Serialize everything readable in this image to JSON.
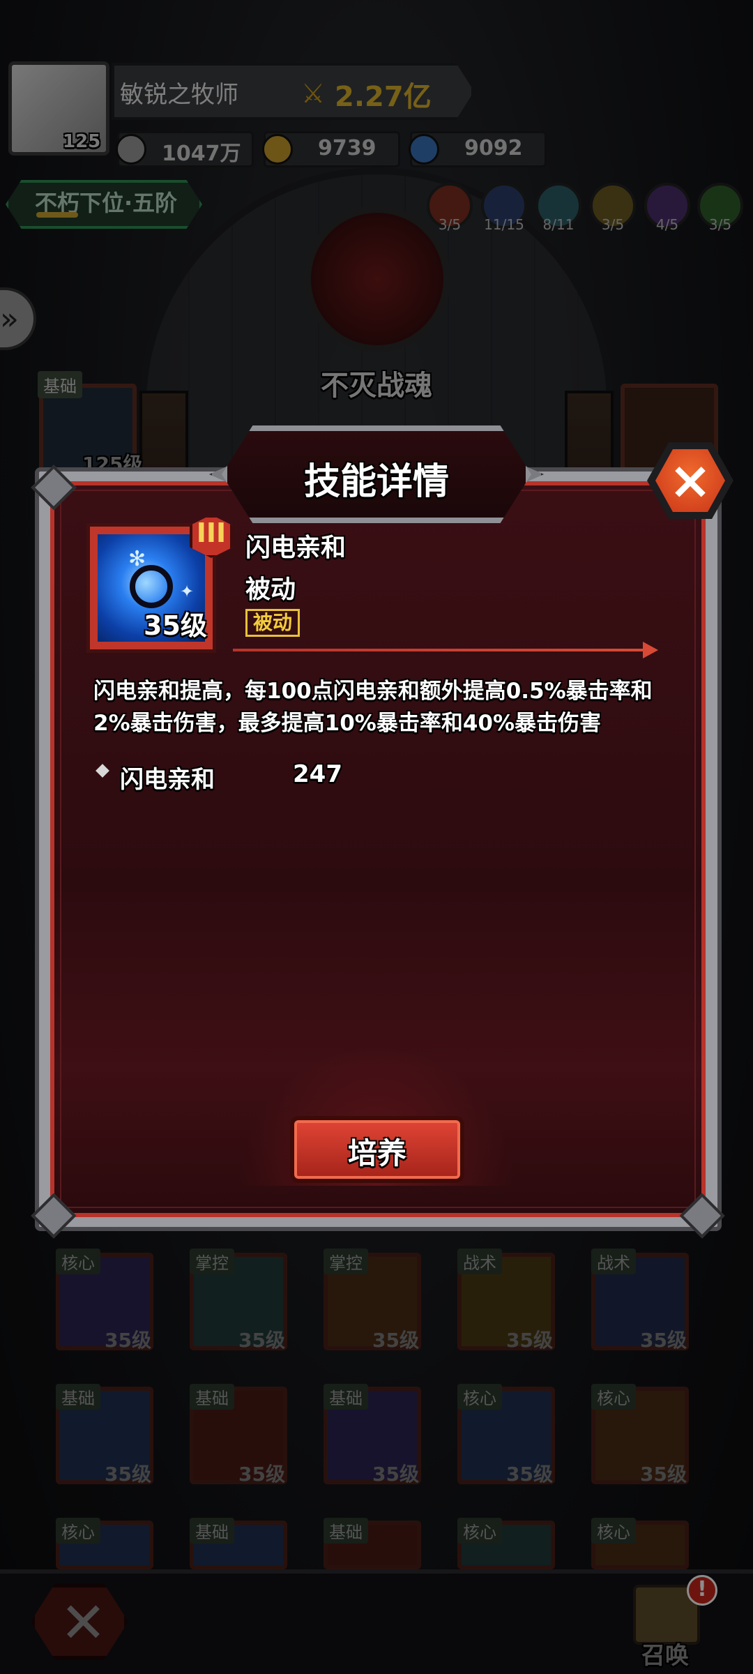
{
  "player": {
    "name": "敏锐之牧师",
    "level": "125",
    "power": "2.27亿"
  },
  "resources": [
    {
      "icon": "silver-coin-icon",
      "value": "1047万"
    },
    {
      "icon": "gold-coin-icon",
      "value": "9739"
    },
    {
      "icon": "crystal-icon",
      "value": "9092"
    }
  ],
  "rank": {
    "label": "不朽下位·五阶"
  },
  "elements": [
    {
      "icon": "fire-element-icon",
      "count": "3/5",
      "color": "#7a2e20"
    },
    {
      "icon": "wind-element-icon",
      "count": "11/15",
      "color": "#2a3e6a"
    },
    {
      "icon": "frost-element-icon",
      "count": "8/11",
      "color": "#2a5e66"
    },
    {
      "icon": "earth-element-icon",
      "count": "3/5",
      "color": "#6a5a22"
    },
    {
      "icon": "moon-element-icon",
      "count": "4/5",
      "color": "#4a2e6a"
    },
    {
      "icon": "nature-element-icon",
      "count": "3/5",
      "color": "#2e5e2a"
    }
  ],
  "background": {
    "emblem_title": "不灭战魂",
    "left_tile": {
      "tag": "基础",
      "level": "125级"
    }
  },
  "modal": {
    "title": "技能详情",
    "close_label": "×",
    "skill": {
      "name": "闪电亲和",
      "type": "被动",
      "type_tag": "被动",
      "tier": "III",
      "level": "35级"
    },
    "description": "闪电亲和提高，每100点闪电亲和额外提高0.5%暴击率和2%暴击伤害，最多提高10%暴击率和40%暴击伤害",
    "stats": [
      {
        "label": "闪电亲和",
        "value": "247"
      }
    ],
    "action_label": "培养"
  },
  "skill_grid": {
    "rows": [
      [
        {
          "tag": "核心",
          "level": "35级"
        },
        {
          "tag": "掌控",
          "level": "35级"
        },
        {
          "tag": "掌控",
          "level": "35级"
        },
        {
          "tag": "战术",
          "level": "35级"
        },
        {
          "tag": "战术",
          "level": "35级"
        }
      ],
      [
        {
          "tag": "基础",
          "level": "35级"
        },
        {
          "tag": "基础",
          "level": "35级"
        },
        {
          "tag": "基础",
          "level": "35级"
        },
        {
          "tag": "核心",
          "level": "35级"
        },
        {
          "tag": "核心",
          "level": "35级"
        }
      ],
      [
        {
          "tag": "核心"
        },
        {
          "tag": "基础"
        },
        {
          "tag": "基础"
        },
        {
          "tag": "核心"
        },
        {
          "tag": "核心"
        }
      ]
    ]
  },
  "bottom_nav": {
    "summon_label": "召唤",
    "summon_alert": "!"
  }
}
